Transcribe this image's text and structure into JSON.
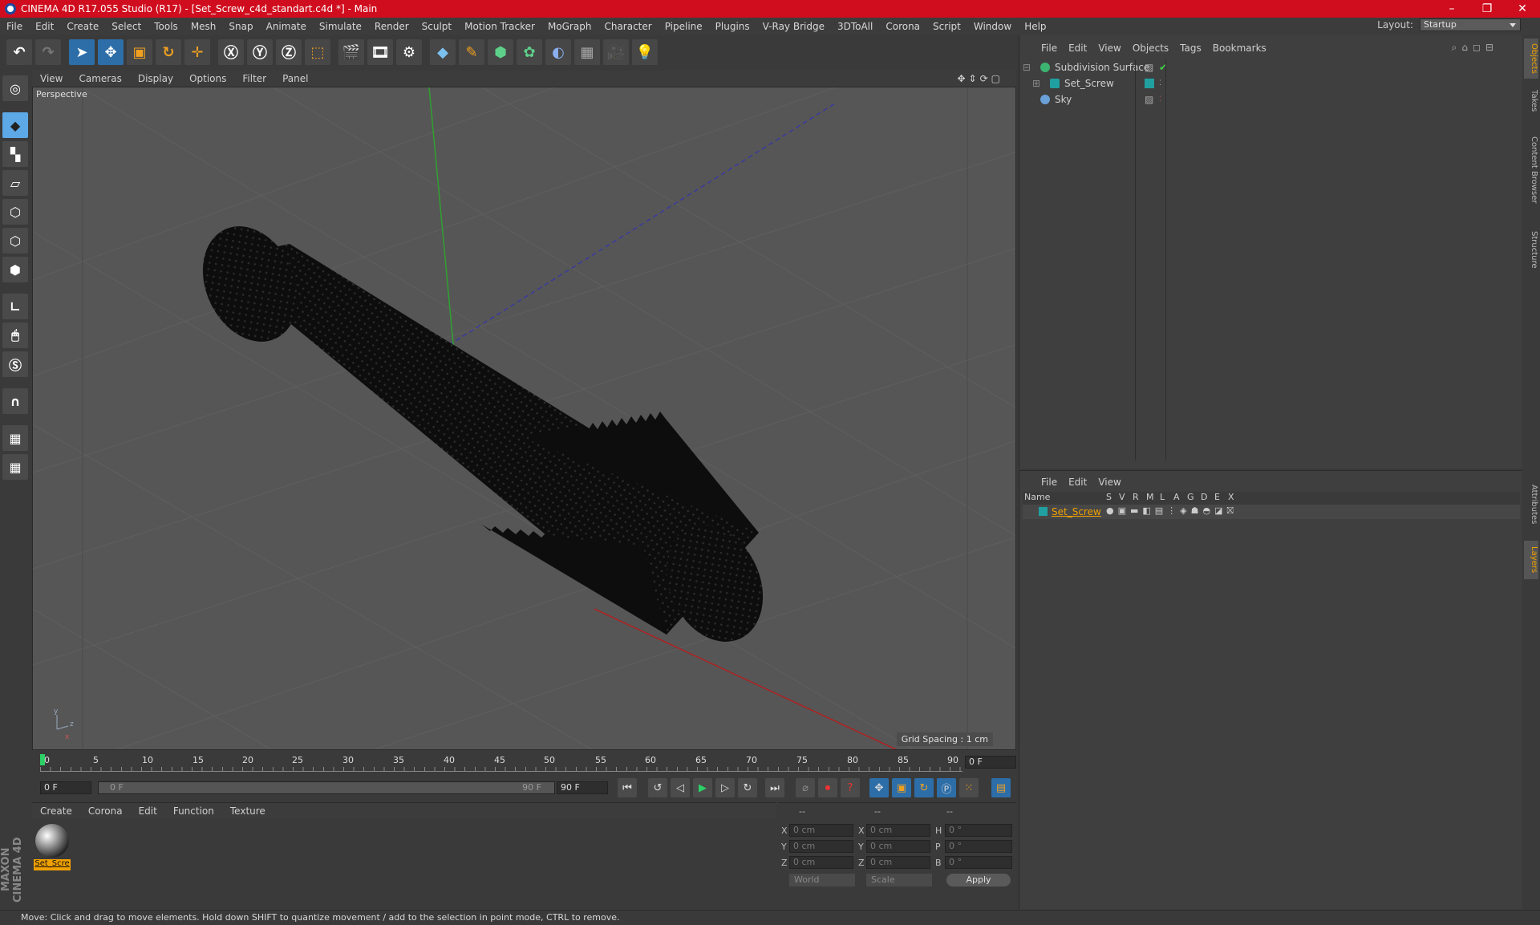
{
  "window": {
    "title": "CINEMA 4D R17.055 Studio (R17) - [Set_Screw_c4d_standart.c4d *] - Main",
    "min": "–",
    "max": "❐",
    "close": "✕"
  },
  "menu": [
    "File",
    "Edit",
    "Create",
    "Select",
    "Tools",
    "Mesh",
    "Snap",
    "Animate",
    "Simulate",
    "Render",
    "Sculpt",
    "Motion Tracker",
    "MoGraph",
    "Character",
    "Pipeline",
    "Plugins",
    "V-Ray Bridge",
    "3DToAll",
    "Corona",
    "Script",
    "Window",
    "Help"
  ],
  "layout": {
    "label": "Layout:",
    "value": "Startup"
  },
  "viewport": {
    "menu": [
      "View",
      "Cameras",
      "Display",
      "Options",
      "Filter",
      "Panel"
    ],
    "label": "Perspective",
    "grid_spacing": "Grid Spacing : 1 cm"
  },
  "timeline": {
    "ticks": [
      "0",
      "5",
      "10",
      "15",
      "20",
      "25",
      "30",
      "35",
      "40",
      "45",
      "50",
      "55",
      "60",
      "65",
      "70",
      "75",
      "80",
      "85",
      "90"
    ],
    "current_frame": "0 F"
  },
  "transport": {
    "start": "0 F",
    "slider_start": "0 F",
    "slider_end": "90 F",
    "end": "90 F"
  },
  "material": {
    "menu": [
      "Create",
      "Corona",
      "Edit",
      "Function",
      "Texture"
    ],
    "name": "Set_Scre"
  },
  "coords": {
    "headers": [
      "--",
      "--",
      "--"
    ],
    "rows": [
      {
        "a": "X",
        "av": "0 cm",
        "b": "X",
        "bv": "0 cm",
        "c": "H",
        "cv": "0 °"
      },
      {
        "a": "Y",
        "av": "0 cm",
        "b": "Y",
        "bv": "0 cm",
        "c": "P",
        "cv": "0 °"
      },
      {
        "a": "Z",
        "av": "0 cm",
        "b": "Z",
        "bv": "0 cm",
        "c": "B",
        "cv": "0 °"
      }
    ],
    "world": "World",
    "scale": "Scale",
    "apply": "Apply"
  },
  "objects": {
    "menu": [
      "File",
      "Edit",
      "View",
      "Objects",
      "Tags",
      "Bookmarks"
    ],
    "items": [
      {
        "name": "Subdivision Surface",
        "color": "#3cb371"
      },
      {
        "name": "Set_Screw",
        "color": "#20a0a0"
      },
      {
        "name": "Sky",
        "color": "#6aa0d8"
      }
    ]
  },
  "layers": {
    "menu": [
      "File",
      "Edit",
      "View"
    ],
    "columns": [
      "Name",
      "S",
      "V",
      "R",
      "M",
      "L",
      "A",
      "G",
      "D",
      "E",
      "X"
    ],
    "row": "Set_Screw"
  },
  "side_tabs": [
    "Objects",
    "Takes",
    "Content Browser",
    "Structure",
    "Attributes",
    "Layers"
  ],
  "status": "Move: Click and drag to move elements. Hold down SHIFT to quantize movement / add to the selection in point mode, CTRL to remove.",
  "brand": "MAXON CINEMA 4D"
}
